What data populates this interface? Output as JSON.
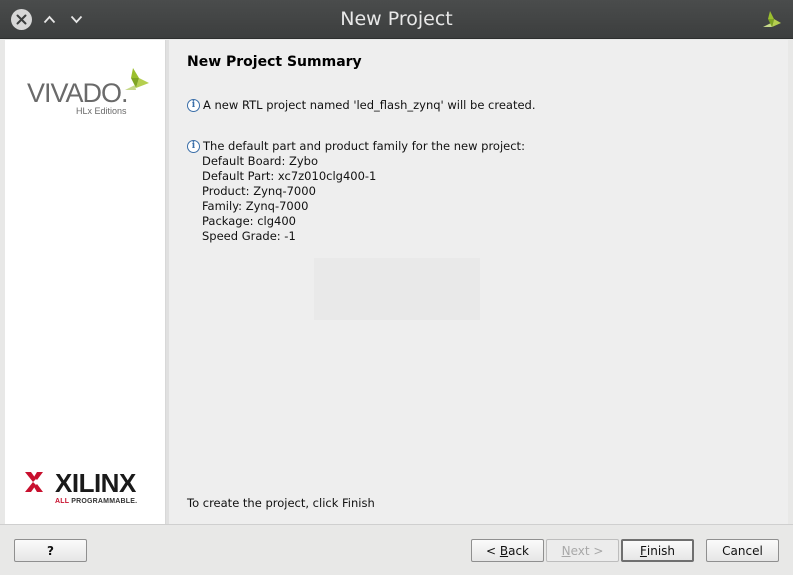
{
  "window": {
    "title": "New Project"
  },
  "sidebar": {
    "vivado_logo_text": "VIVADO.",
    "vivado_logo_subtitle": "HLx Editions",
    "xilinx_logo_text": "XILINX",
    "xilinx_tagline_part1": "ALL",
    "xilinx_tagline_part2": "PROGRAMMABLE."
  },
  "main": {
    "heading": "New Project Summary",
    "info1": "A new RTL project named 'led_flash_zynq' will be created.",
    "info2": "The default part and product family for the new project:",
    "details": [
      "Default Board: Zybo",
      "Default Part: xc7z010clg400-1",
      "Product: Zynq-7000",
      "Family: Zynq-7000",
      "Package: clg400",
      "Speed Grade: -1"
    ],
    "footer": "To create the project, click Finish"
  },
  "buttons": {
    "help": "?",
    "back_prefix": "< ",
    "back_mnemonic": "B",
    "back_rest": "ack",
    "next_prefix": "",
    "next_mnemonic": "N",
    "next_rest": "ext >",
    "finish_mnemonic": "F",
    "finish_rest": "inish",
    "cancel": "Cancel"
  },
  "icons": {
    "close": "close-icon",
    "up": "chevron-up-icon",
    "down": "chevron-down-icon",
    "info": "info-icon"
  },
  "colors": {
    "titlebar": "#3c3e3e",
    "vivado_green": "#9bbf2e",
    "xilinx_red": "#c8102e"
  }
}
